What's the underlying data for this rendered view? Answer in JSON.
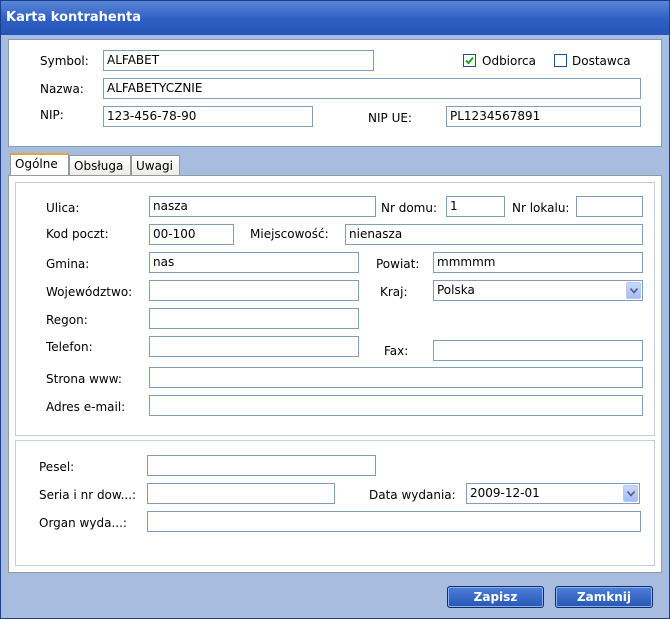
{
  "window": {
    "title": "Karta kontrahenta"
  },
  "header": {
    "symbol_label": "Symbol:",
    "symbol_value": "ALFABET",
    "nazwa_label": "Nazwa:",
    "nazwa_value": "ALFABETYCZNIE",
    "nip_label": "NIP:",
    "nip_value": "123-456-78-90",
    "nipue_label": "NIP UE:",
    "nipue_value": "PL1234567891",
    "odbiorca_label": "Odbiorca",
    "odbiorca_checked": true,
    "dostawca_label": "Dostawca",
    "dostawca_checked": false
  },
  "tabs": [
    {
      "label": "Ogólne",
      "active": true
    },
    {
      "label": "Obsługa",
      "active": false
    },
    {
      "label": "Uwagi",
      "active": false
    }
  ],
  "address": {
    "ulica_label": "Ulica:",
    "ulica_value": "nasza",
    "nrdomu_label": "Nr domu:",
    "nrdomu_value": "1",
    "nrlokalu_label": "Nr lokalu:",
    "nrlokalu_value": "",
    "kod_label": "Kod poczt:",
    "kod_value": "00-100",
    "miejscowosc_label": "Miejscowość:",
    "miejscowosc_value": "nienasza",
    "gmina_label": "Gmina:",
    "gmina_value": "nas",
    "powiat_label": "Powiat:",
    "powiat_value": "mmmmm",
    "wojewodztwo_label": "Województwo:",
    "wojewodztwo_value": "",
    "kraj_label": "Kraj:",
    "kraj_value": "Polska",
    "regon_label": "Regon:",
    "regon_value": "",
    "telefon_label": "Telefon:",
    "telefon_value": "",
    "fax_label": "Fax:",
    "fax_value": "",
    "www_label": "Strona www:",
    "www_value": "",
    "email_label": "Adres e-mail:",
    "email_value": ""
  },
  "personal": {
    "pesel_label": "Pesel:",
    "pesel_value": "",
    "seria_label": "Seria i nr dow...:",
    "seria_value": "",
    "data_label": "Data wydania:",
    "data_value": "2009-12-01",
    "organ_label": "Organ wyda...:",
    "organ_value": ""
  },
  "buttons": {
    "save": "Zapisz",
    "close": "Zamknij"
  },
  "colors": {
    "title_bar": "#2e5fc2",
    "window_bg": "#a8bcdf",
    "tab_accent": "#e6a33c",
    "button": "#2757b6"
  },
  "icons": [
    "checkmark-icon",
    "chevron-down-icon"
  ]
}
